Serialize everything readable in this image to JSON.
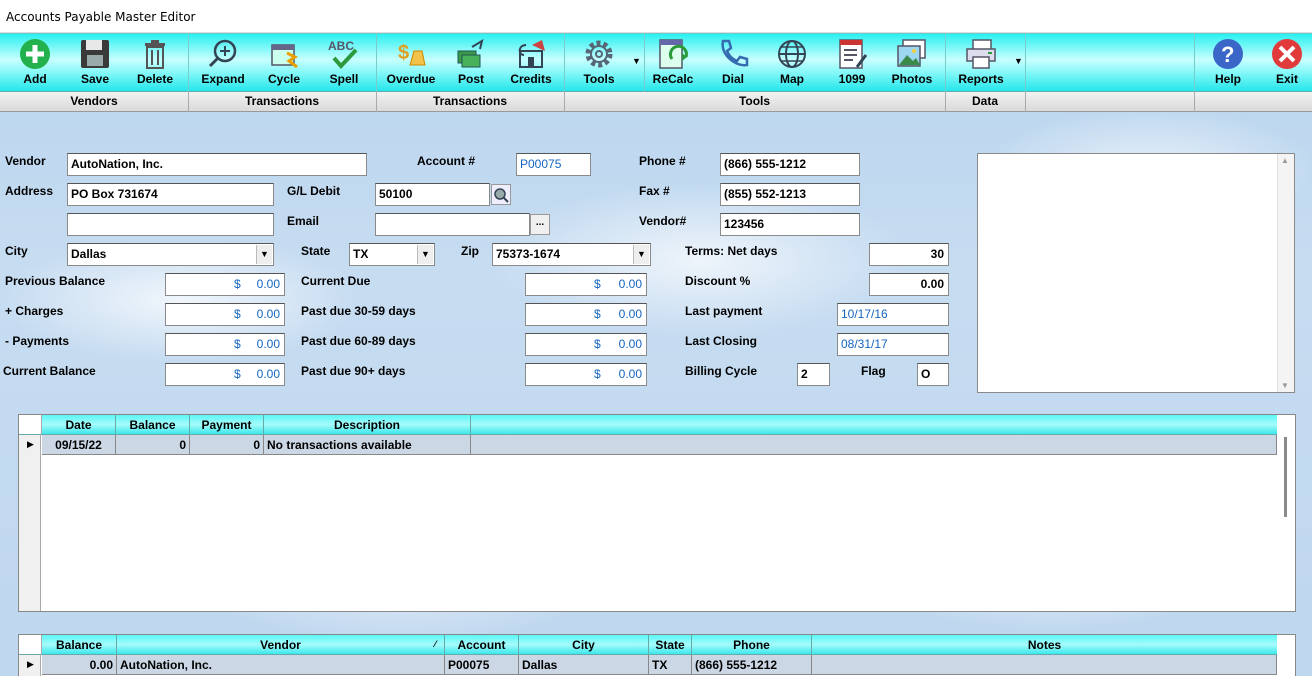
{
  "window": {
    "title": "Accounts Payable Master Editor"
  },
  "toolbar": {
    "buttons": [
      {
        "label": "Add",
        "icon": "add-icon"
      },
      {
        "label": "Save",
        "icon": "save-icon"
      },
      {
        "label": "Delete",
        "icon": "delete-icon"
      },
      {
        "label": "Expand",
        "icon": "expand-icon"
      },
      {
        "label": "Cycle",
        "icon": "cycle-icon"
      },
      {
        "label": "Spell",
        "icon": "spell-icon"
      },
      {
        "label": "Overdue",
        "icon": "overdue-icon"
      },
      {
        "label": "Post",
        "icon": "post-icon"
      },
      {
        "label": "Credits",
        "icon": "credits-icon"
      },
      {
        "label": "Tools",
        "icon": "gear-icon"
      },
      {
        "label": "ReCalc",
        "icon": "recalc-icon"
      },
      {
        "label": "Dial",
        "icon": "phone-icon"
      },
      {
        "label": "Map",
        "icon": "globe-icon"
      },
      {
        "label": "1099",
        "icon": "form-1099-icon"
      },
      {
        "label": "Photos",
        "icon": "photos-icon"
      },
      {
        "label": "Reports",
        "icon": "reports-icon"
      },
      {
        "label": "Help",
        "icon": "help-icon"
      },
      {
        "label": "Exit",
        "icon": "exit-icon"
      }
    ],
    "groups": [
      "Vendors",
      "Transactions",
      "Transactions",
      "Tools",
      "Data"
    ],
    "spell_icon_text": "ABC"
  },
  "form": {
    "vendor_label": "Vendor",
    "vendor": "AutoNation, Inc.",
    "account_label": "Account #",
    "account": "P00075",
    "phone_label": "Phone #",
    "phone": "(866) 555-1212",
    "address_label": "Address",
    "address1": "PO Box 731674",
    "address2": "",
    "gl_label": "G/L Debit",
    "gl": "50100",
    "fax_label": "Fax #",
    "fax": "(855) 552-1213",
    "email_label": "Email",
    "email": "",
    "vendorno_label": "Vendor#",
    "vendorno": "123456",
    "city_label": "City",
    "city": "Dallas",
    "state_label": "State",
    "state": "TX",
    "zip_label": "Zip",
    "zip": "75373-1674",
    "terms_label": "Terms: Net days",
    "terms": "30",
    "discount_label": "Discount %",
    "discount": "0.00",
    "last_payment_label": "Last payment",
    "last_payment": "10/17/16",
    "last_closing_label": "Last Closing",
    "last_closing": "08/31/17",
    "billing_cycle_label": "Billing Cycle",
    "billing_cycle": "2",
    "flag_label": "Flag",
    "flag": "O",
    "ellipsis": "...",
    "currency": "$",
    "prev_balance_label": "Previous Balance",
    "prev_balance": "0.00",
    "charges_label": "+ Charges",
    "charges": "0.00",
    "payments_label": "- Payments",
    "payments": "0.00",
    "current_balance_label": "Current Balance",
    "current_balance": "0.00",
    "current_due_label": "Current Due",
    "current_due": "0.00",
    "past30_label": "Past due 30-59 days",
    "past30": "0.00",
    "past60_label": "Past due 60-89 days",
    "past60": "0.00",
    "past90_label": "Past due 90+ days",
    "past90": "0.00"
  },
  "transactions": {
    "headers": [
      "Date",
      "Balance",
      "Payment",
      "Description"
    ],
    "rows": [
      {
        "date": "09/15/22",
        "balance": "0",
        "payment": "0",
        "description": "No transactions available"
      }
    ]
  },
  "vendors": {
    "headers": [
      "Balance",
      "Vendor",
      "Account",
      "City",
      "State",
      "Phone",
      "Notes"
    ],
    "rows": [
      {
        "balance": "0.00",
        "vendor": "AutoNation, Inc.",
        "account": "P00075",
        "city": "Dallas",
        "state": "TX",
        "phone": "(866) 555-1212",
        "notes": ""
      }
    ]
  }
}
